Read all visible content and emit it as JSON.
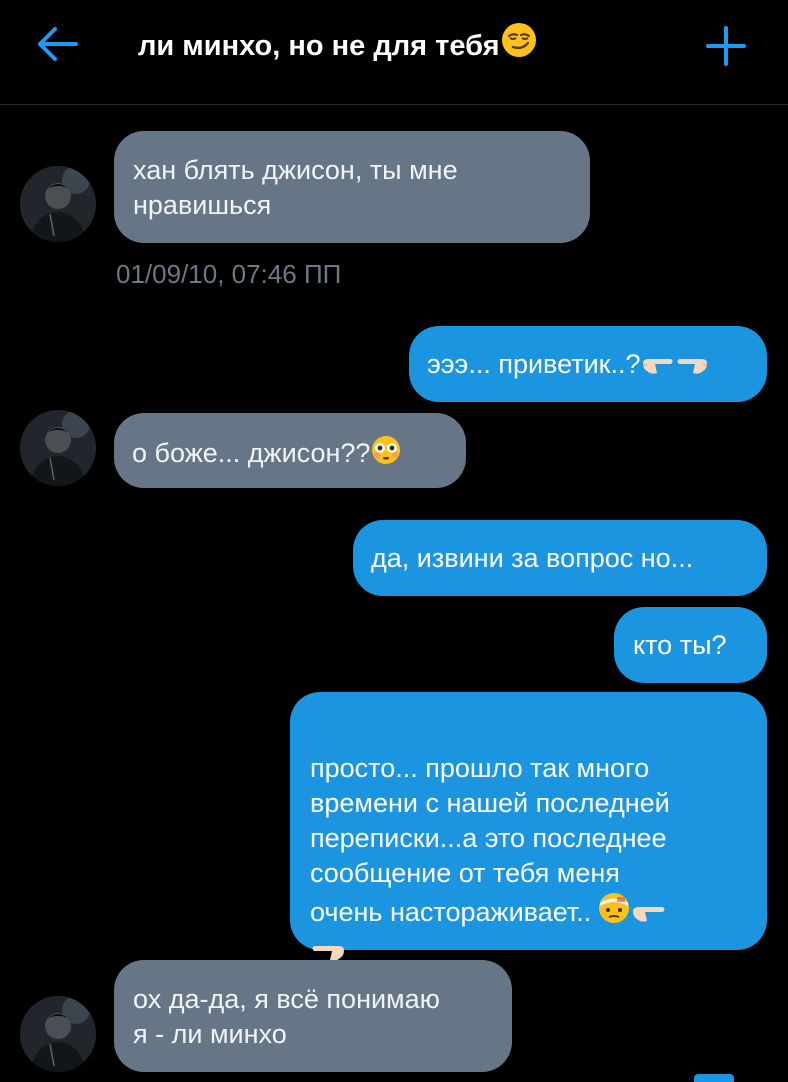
{
  "header": {
    "title": "ли минхо, но не для тебя",
    "title_emoji": "smirking-face-emoji",
    "back_icon": "arrow-left-icon",
    "add_icon": "plus-icon",
    "accent_color": "#1d9bf0"
  },
  "conversation": {
    "timestamp": "01/09/10, 07:46 ПП",
    "messages": [
      {
        "direction": "incoming",
        "text": "хан блять джисон, ты мне\nнравишься"
      },
      {
        "direction": "outgoing",
        "text": "эээ... приветик..?",
        "emoji": [
          "pointing-right-emoji",
          "pointing-left-emoji"
        ]
      },
      {
        "direction": "incoming",
        "text": "о боже... джисон??",
        "emoji": [
          "flushed-face-emoji"
        ]
      },
      {
        "direction": "outgoing",
        "text": "да, извини за вопрос но..."
      },
      {
        "direction": "outgoing",
        "text": "кто ты?"
      },
      {
        "direction": "outgoing",
        "text": "просто... прошло так много\nвремени с нашей последней\nпереписки...а это последнее\nсообщение от тебя меня\nочень настораживает..",
        "emoji": [
          "face-with-head-bandage-emoji",
          "pointing-right-emoji",
          "pointing-left-emoji"
        ]
      },
      {
        "direction": "incoming",
        "text": "ох да-да, я всё понимаю\nя - ли минхо"
      }
    ]
  },
  "colors": {
    "incoming_bubble": "#667686",
    "outgoing_bubble": "#1b95e0",
    "timestamp": "#6b7886",
    "background": "#000000"
  }
}
